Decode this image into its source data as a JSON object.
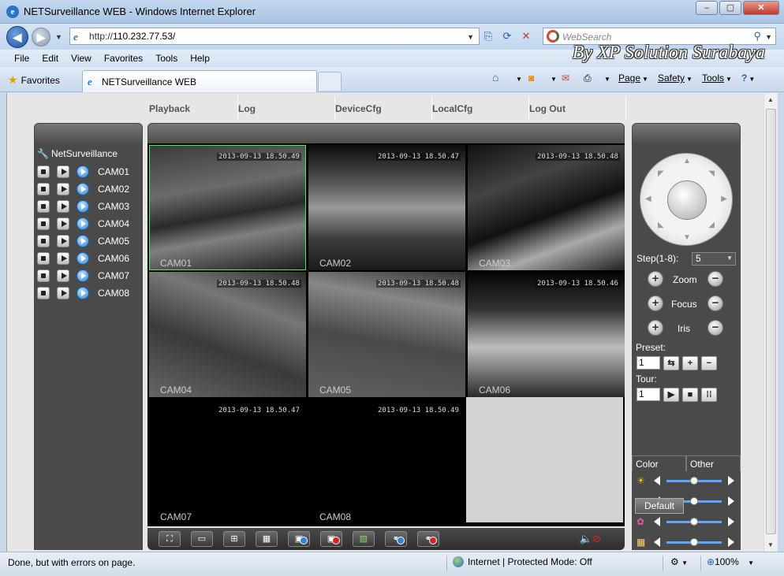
{
  "window": {
    "title": "NETSurveillance WEB - Windows Internet Explorer",
    "controls": [
      "–",
      "▢",
      "✕"
    ]
  },
  "address": {
    "url_prefix": "http://",
    "url_host": "110.232.77.53/",
    "search_placeholder": "WebSearch"
  },
  "menu": [
    "File",
    "Edit",
    "View",
    "Favorites",
    "Tools",
    "Help"
  ],
  "watermark": "By XP Solution Surabaya",
  "favorites": {
    "label": "Favorites",
    "tab_title": "NETSurveillance WEB",
    "commands": [
      "Page",
      "Safety",
      "Tools"
    ]
  },
  "app": {
    "nav": [
      "Playback",
      "Log",
      "DeviceCfg",
      "LocalCfg",
      "Log Out"
    ],
    "tree_root": "NetSurveillance",
    "cameras": [
      "CAM01",
      "CAM02",
      "CAM03",
      "CAM04",
      "CAM05",
      "CAM06",
      "CAM07",
      "CAM08"
    ],
    "tiles": [
      {
        "cam": "CAM01",
        "timestamp": "2013-09-13 18.50.49",
        "selected": true
      },
      {
        "cam": "CAM02",
        "timestamp": "2013-09-13 18.50.47"
      },
      {
        "cam": "CAM03",
        "timestamp": "2013-09-13 18.50.48"
      },
      {
        "cam": "CAM04",
        "timestamp": "2013-09-13 18.50.48"
      },
      {
        "cam": "CAM05",
        "timestamp": "2013-09-13 18.50.48"
      },
      {
        "cam": "CAM06",
        "timestamp": "2013-09-13 18.50.46"
      },
      {
        "cam": "CAM07",
        "timestamp": "2013-09-13 18.50.47"
      },
      {
        "cam": "CAM08",
        "timestamp": "2013-09-13 18.50.49"
      }
    ],
    "ptz": {
      "step_label": "Step(1-8):",
      "step_value": "5",
      "zoom": "Zoom",
      "focus": "Focus",
      "iris": "Iris",
      "preset_label": "Preset:",
      "preset_value": "1",
      "tour_label": "Tour:",
      "tour_value": "1"
    },
    "color_tabs": [
      "Color",
      "Other"
    ],
    "sliders": [
      {
        "icon": "brightness-icon",
        "level": 0.5
      },
      {
        "icon": "contrast-icon",
        "level": 0.5
      },
      {
        "icon": "saturation-icon",
        "level": 0.5
      },
      {
        "icon": "hue-icon",
        "level": 0.5
      }
    ],
    "default_button": "Default"
  },
  "status": {
    "text": "Done, but with errors on page.",
    "zone": "Internet | Protected Mode: Off",
    "zoom": "100%"
  },
  "colors": {
    "accent": "#2a74c9",
    "panel": "#4a4a4a",
    "selected_tile": "#3ef05a",
    "slider": "#5ca6ff"
  }
}
